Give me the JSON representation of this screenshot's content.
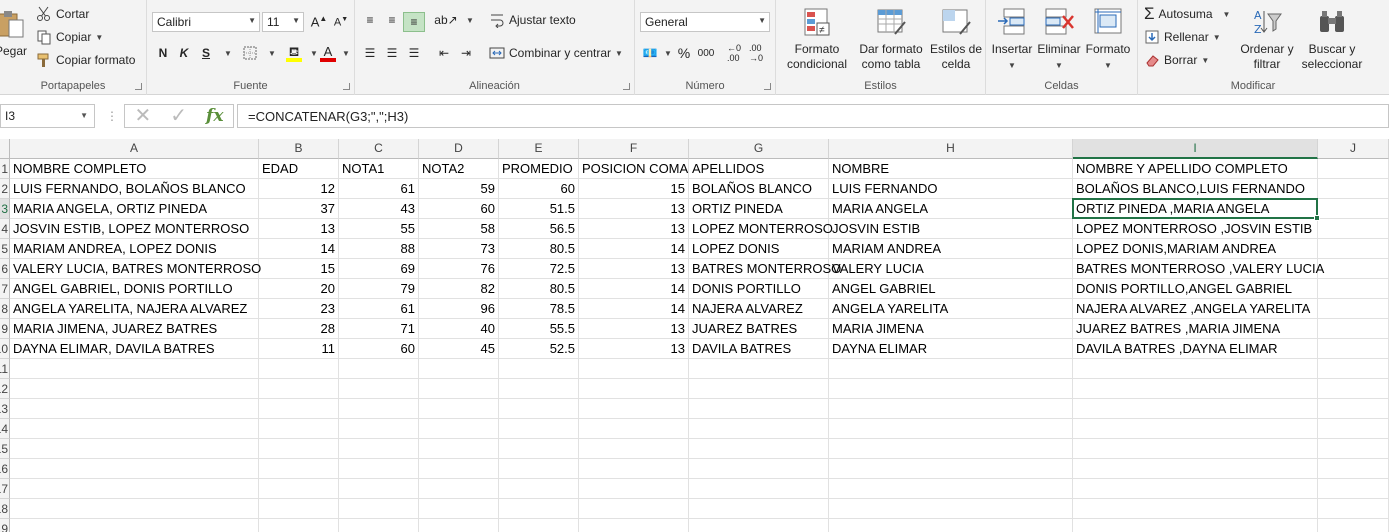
{
  "ribbon": {
    "clipboard": {
      "paste": "Pegar",
      "cut": "Cortar",
      "copy": "Copiar",
      "format_painter": "Copiar formato",
      "label": "Portapapeles"
    },
    "font": {
      "name": "Calibri",
      "size": "11",
      "bold": "N",
      "italic": "K",
      "underline": "S",
      "label": "Fuente"
    },
    "alignment": {
      "wrap": "Ajustar texto",
      "merge": "Combinar y centrar",
      "label": "Alineación"
    },
    "number": {
      "format": "General",
      "percent": "%",
      "thousands": "000",
      "label": "Número"
    },
    "styles": {
      "conditional": "Formato condicional",
      "table": "Dar formato como tabla",
      "cell_styles": "Estilos de celda",
      "label": "Estilos"
    },
    "cells": {
      "insert": "Insertar",
      "delete": "Eliminar",
      "format": "Formato",
      "label": "Celdas"
    },
    "editing": {
      "autosum": "Autosuma",
      "fill": "Rellenar",
      "clear": "Borrar",
      "sort": "Ordenar y filtrar",
      "find": "Buscar y seleccionar",
      "label": "Modificar"
    }
  },
  "formula_bar": {
    "name_box": "I3",
    "fx": "fx",
    "formula": "=CONCATENAR(G3;\",\";H3)"
  },
  "sheet": {
    "columns": [
      "A",
      "B",
      "C",
      "D",
      "E",
      "F",
      "G",
      "H",
      "I",
      "J"
    ],
    "row_numbers": [
      "1",
      "2",
      "3",
      "4",
      "5",
      "6",
      "7",
      "8",
      "9",
      "10",
      "11",
      "12",
      "13",
      "14",
      "15",
      "16",
      "17",
      "18",
      "19"
    ],
    "header": [
      "NOMBRE COMPLETO",
      "EDAD",
      "NOTA1",
      "NOTA2",
      "PROMEDIO",
      "POSICION COMA",
      "APELLIDOS",
      "NOMBRE",
      "NOMBRE Y APELLIDO COMPLETO"
    ],
    "rows": [
      [
        "LUIS FERNANDO, BOLAÑOS BLANCO",
        "12",
        "61",
        "59",
        "60",
        "15",
        "BOLAÑOS BLANCO",
        "LUIS FERNANDO",
        "BOLAÑOS BLANCO,LUIS FERNANDO"
      ],
      [
        "MARIA ANGELA, ORTIZ PINEDA",
        "37",
        "43",
        "60",
        "51.5",
        "13",
        "ORTIZ PINEDA",
        "MARIA ANGELA",
        "ORTIZ PINEDA ,MARIA ANGELA"
      ],
      [
        "JOSVIN ESTIB, LOPEZ MONTERROSO",
        "13",
        "55",
        "58",
        "56.5",
        "13",
        "LOPEZ MONTERROSO",
        "JOSVIN ESTIB",
        "LOPEZ MONTERROSO ,JOSVIN ESTIB"
      ],
      [
        "MARIAM ANDREA, LOPEZ DONIS",
        "14",
        "88",
        "73",
        "80.5",
        "14",
        "LOPEZ DONIS",
        "MARIAM ANDREA",
        "LOPEZ DONIS,MARIAM ANDREA"
      ],
      [
        "VALERY LUCIA, BATRES MONTERROSO",
        "15",
        "69",
        "76",
        "72.5",
        "13",
        "BATRES MONTERROSO",
        "VALERY LUCIA",
        "BATRES MONTERROSO ,VALERY LUCIA"
      ],
      [
        "ANGEL GABRIEL, DONIS PORTILLO",
        "20",
        "79",
        "82",
        "80.5",
        "14",
        "DONIS PORTILLO",
        "ANGEL GABRIEL",
        "DONIS PORTILLO,ANGEL GABRIEL"
      ],
      [
        "ANGELA YARELITA, NAJERA ALVAREZ",
        "23",
        "61",
        "96",
        "78.5",
        "14",
        "NAJERA ALVAREZ",
        "ANGELA YARELITA",
        "NAJERA ALVAREZ ,ANGELA YARELITA"
      ],
      [
        "MARIA JIMENA, JUAREZ BATRES",
        "28",
        "71",
        "40",
        "55.5",
        "13",
        "JUAREZ BATRES",
        "MARIA JIMENA",
        "JUAREZ BATRES ,MARIA JIMENA"
      ],
      [
        "DAYNA ELIMAR, DAVILA BATRES",
        "11",
        "60",
        "45",
        "52.5",
        "13",
        "DAVILA BATRES",
        "DAYNA ELIMAR",
        "DAVILA BATRES ,DAYNA ELIMAR"
      ]
    ],
    "selected_cell": "I3",
    "accent_color": "#217346"
  }
}
